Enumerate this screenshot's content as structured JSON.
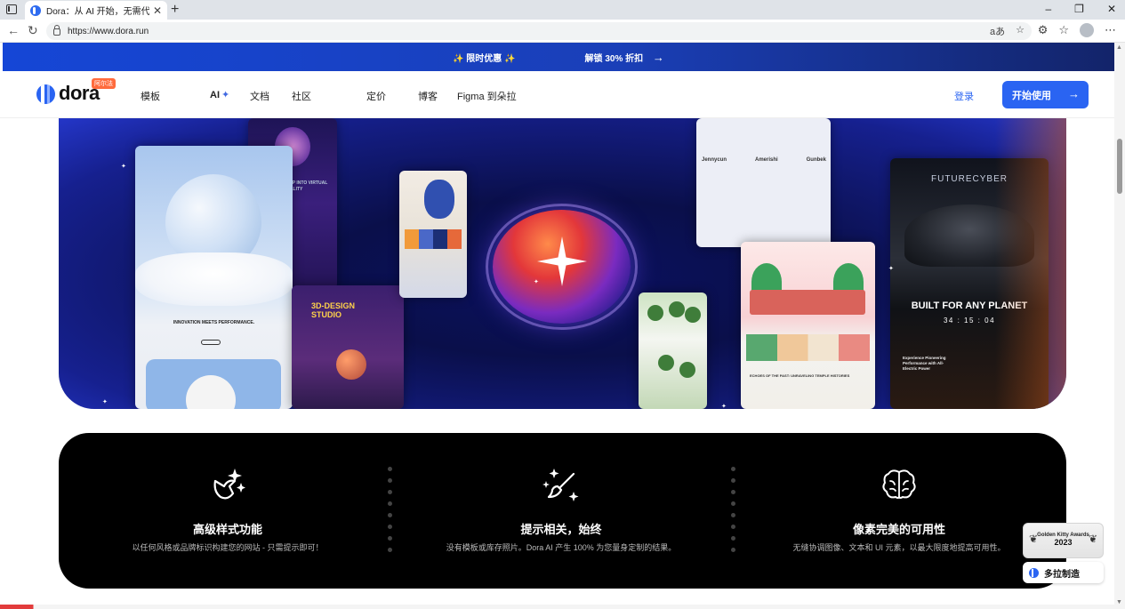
{
  "browser": {
    "tab_title": "Dora：从 AI 开始，无需代码即可",
    "tab_close": "✕",
    "new_tab": "+",
    "window_controls": [
      "–",
      "❐",
      "✕"
    ],
    "url": "https://www.dora.run",
    "reader_icon": "aあ",
    "icons": [
      "sidebar-icon",
      "back-icon",
      "refresh-icon",
      "lock-icon",
      "translate-icon",
      "star-icon",
      "extensions-icon",
      "favorites-icon",
      "profile-icon",
      "more-icon"
    ]
  },
  "promo": {
    "offer": "✨ 限时优惠 ✨",
    "unlock": "解锁 30% 折扣",
    "arrow": "→"
  },
  "header": {
    "logo_text": "dora",
    "logo_badge": "阿尔法",
    "nav": {
      "templates": "模板",
      "ai": "AI",
      "ai_sparkle": "✦",
      "docs": "文档",
      "community": "社区",
      "pricing": "定价",
      "blog": "博客",
      "figma": "Figma 到朵拉"
    },
    "login": "登录",
    "cta": "开始使用",
    "cta_arrow": "→",
    "brand_color": "#2a64f2"
  },
  "hero": {
    "nike_caption": "INNOVATION MEETS PERFORMANCE.",
    "vr_text": "STEP INTO VIRTUAL REALITY",
    "design_studio": "3D-DESIGN STUDIO",
    "brands": [
      "Jennycun",
      "Amerishi",
      "Gunbek"
    ],
    "temple_caption": "ECHOES OF THE PAST: UNRAVELING TEMPLE HISTORIES",
    "car_title": "FUTURECYBER",
    "car_tagline": "BUILT FOR ANY PLANET",
    "car_timer": "34 : 15 : 04",
    "car_desc": "Experience Pioneering Performance with All-Electric Power"
  },
  "features": [
    {
      "icon": "magic-sparkle-icon",
      "title": "高级样式功能",
      "desc": "以任何风格或品牌标识构建您的网站 - 只需提示即可！"
    },
    {
      "icon": "paintbrush-sparkle-icon",
      "title": "提示相关，始终",
      "desc": "没有模板或库存照片。Dora AI 产生 100% 为您量身定制的结果。"
    },
    {
      "icon": "brain-icon",
      "title": "像素完美的可用性",
      "desc": "无缝协调图像、文本和 UI 元素，以最大限度地提高可用性。"
    }
  ],
  "award": {
    "name": "Golden Kitty Awards",
    "year": "2023"
  },
  "made_by": "多拉制造"
}
